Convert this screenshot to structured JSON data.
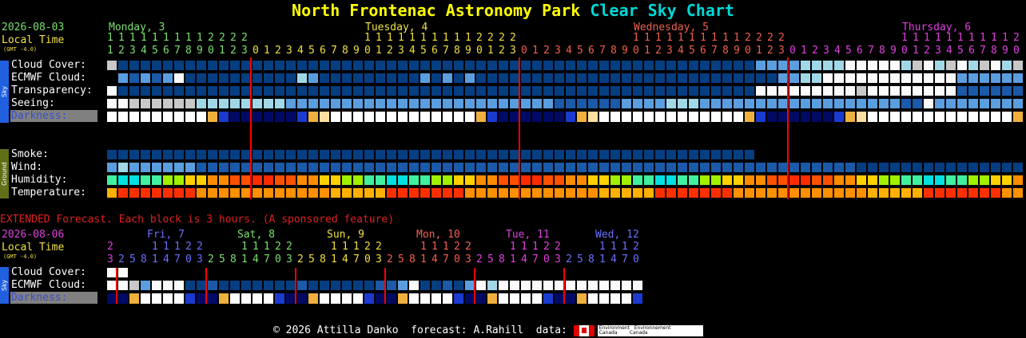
{
  "title": {
    "part1": "North Frontenac Astronomy Park",
    "part2": "Clear Sky Chart",
    "color1": "#ffff00",
    "color2": "#00d8d8"
  },
  "header": {
    "date": "2026-08-03",
    "local_time": "Local Time",
    "gmt": "(GMT -4.0)",
    "days": [
      {
        "label": "Monday, 3",
        "color": "#7ce070"
      },
      {
        "label": "Tuesday, 4",
        "color": "#f0e040"
      },
      {
        "label": "Wednesday, 5",
        "color": "#f06050"
      },
      {
        "label": "Thursday, 6",
        "color": "#e040e0"
      }
    ],
    "tens_row": "1111111111222200000000001111111111222200000000001111111111222200000000001111111111",
    "ones_row": "1234567890123012345678901230123456789012301234567890123012345678901230"
  },
  "sky_rows": [
    "Cloud Cover:",
    "ECMWF Cloud:",
    "Transparency:",
    "Seeing:"
  ],
  "darkness_label": "Darkness:",
  "ground_rows": [
    "Smoke:",
    "Wind:",
    "Humidity:",
    "Temperature:"
  ],
  "sidebar": {
    "sky": "Sky",
    "ground": "Ground"
  },
  "extended": {
    "note": "EXTENDED Forecast. Each block is 3 hours. (A sponsored feature)",
    "date": "2026-08-06",
    "local_time": "Local Time",
    "gmt": "(GMT -4.0)",
    "days": [
      {
        "label": "Fri, 7",
        "color": "#6a70ff"
      },
      {
        "label": "Sat, 8",
        "color": "#7ce070"
      },
      {
        "label": "Sun, 9",
        "color": "#f0e040"
      },
      {
        "label": "Mon, 10",
        "color": "#f06050"
      },
      {
        "label": "Tue, 11",
        "color": "#e040e0"
      },
      {
        "label": "Wed, 12",
        "color": "#6a70ff"
      }
    ],
    "rows": [
      "Cloud Cover:",
      "ECMWF Cloud:"
    ],
    "darkness_label": "Darkness:"
  },
  "footer": {
    "text": "© 2026 Attilla Danko  forecast: A.Rahill  data:",
    "logo_line1": "Environment   Environnement",
    "logo_line2": "Canada        Canada"
  }
}
